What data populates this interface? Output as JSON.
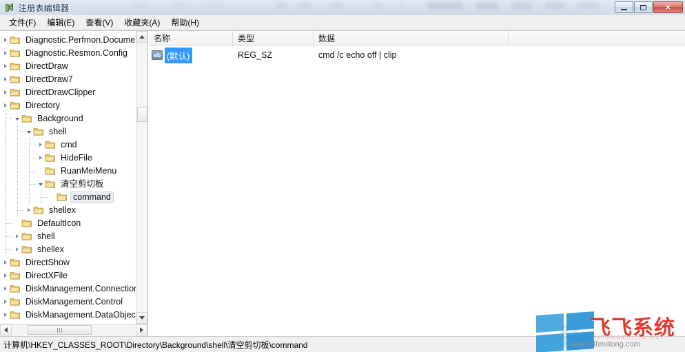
{
  "window": {
    "title": "注册表编辑器",
    "icon": "registry-editor-icon",
    "controls": {
      "minimize": "最小化",
      "maximize": "最大化",
      "close": "×"
    }
  },
  "menubar": {
    "items": [
      {
        "label": "文件(F)",
        "name": "menu-file"
      },
      {
        "label": "编辑(E)",
        "name": "menu-edit"
      },
      {
        "label": "查看(V)",
        "name": "menu-view"
      },
      {
        "label": "收藏夹(A)",
        "name": "menu-favorites"
      },
      {
        "label": "帮助(H)",
        "name": "menu-help"
      }
    ]
  },
  "tree": {
    "nodes": [
      {
        "label": "Diagnostic.Perfmon.Document",
        "depth": 0,
        "twisty": "collapsed",
        "selected": false
      },
      {
        "label": "Diagnostic.Resmon.Config",
        "depth": 0,
        "twisty": "collapsed",
        "selected": false
      },
      {
        "label": "DirectDraw",
        "depth": 0,
        "twisty": "collapsed",
        "selected": false
      },
      {
        "label": "DirectDraw7",
        "depth": 0,
        "twisty": "collapsed",
        "selected": false
      },
      {
        "label": "DirectDrawClipper",
        "depth": 0,
        "twisty": "collapsed",
        "selected": false
      },
      {
        "label": "Directory",
        "depth": 0,
        "twisty": "collapsed",
        "selected": false
      },
      {
        "label": "Background",
        "depth": 1,
        "twisty": "expanded",
        "selected": false
      },
      {
        "label": "shell",
        "depth": 2,
        "twisty": "expanded",
        "selected": false
      },
      {
        "label": "cmd",
        "depth": 3,
        "twisty": "collapsed",
        "selected": false
      },
      {
        "label": "HideFile",
        "depth": 3,
        "twisty": "collapsed",
        "selected": false
      },
      {
        "label": "RuanMeiMenu",
        "depth": 3,
        "twisty": "none",
        "selected": false
      },
      {
        "label": "清空剪切板",
        "depth": 3,
        "twisty": "expanded",
        "selected": false
      },
      {
        "label": "command",
        "depth": 4,
        "twisty": "none",
        "selected": true
      },
      {
        "label": "shellex",
        "depth": 2,
        "twisty": "collapsed",
        "selected": false
      },
      {
        "label": "DefaultIcon",
        "depth": 1,
        "twisty": "none",
        "selected": false
      },
      {
        "label": "shell",
        "depth": 1,
        "twisty": "collapsed",
        "selected": false
      },
      {
        "label": "shellex",
        "depth": 1,
        "twisty": "collapsed",
        "selected": false
      },
      {
        "label": "DirectShow",
        "depth": 0,
        "twisty": "collapsed",
        "selected": false
      },
      {
        "label": "DirectXFile",
        "depth": 0,
        "twisty": "collapsed",
        "selected": false
      },
      {
        "label": "DiskManagement.Connection",
        "depth": 0,
        "twisty": "collapsed",
        "selected": false
      },
      {
        "label": "DiskManagement.Control",
        "depth": 0,
        "twisty": "collapsed",
        "selected": false
      },
      {
        "label": "DiskManagement.DataObject",
        "depth": 0,
        "twisty": "collapsed",
        "selected": false
      }
    ]
  },
  "list": {
    "columns": [
      {
        "label": "名称",
        "name": "column-name"
      },
      {
        "label": "类型",
        "name": "column-type"
      },
      {
        "label": "数据",
        "name": "column-data"
      },
      {
        "label": "",
        "name": "column-filler"
      }
    ],
    "rows": [
      {
        "name": "(默认)",
        "type": "REG_SZ",
        "data": "cmd /c echo off | clip",
        "icon": "ab",
        "selected": true
      }
    ]
  },
  "statusbar": {
    "path": "计算机\\HKEY_CLASSES_ROOT\\Directory\\Background\\shell\\清空剪切板\\command"
  },
  "watermark": {
    "brand": "飞飞系统",
    "pinyin": "XITONGZHIJIA.NET",
    "url": "www.feifeixitong.com",
    "logo": "windows-logo"
  },
  "colors": {
    "selection_blue": "#3399ff",
    "close_red": "#cf5244",
    "brand_red": "#e03126",
    "logo_blue": "#3aa0dd"
  }
}
